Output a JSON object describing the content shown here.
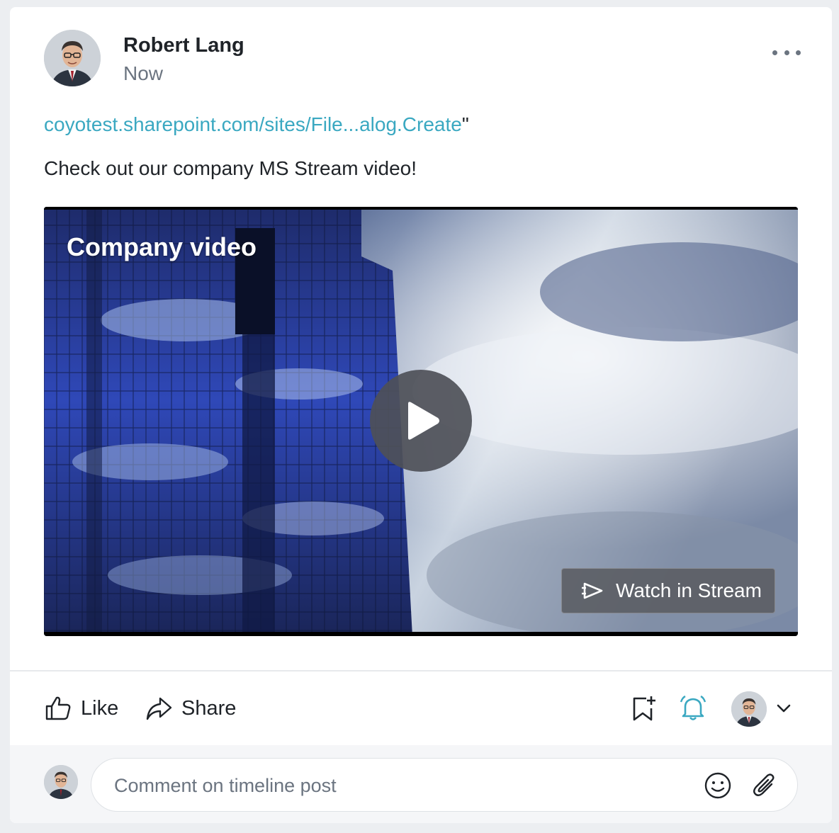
{
  "post": {
    "author": "Robert Lang",
    "time": "Now",
    "link_text": "coyotest.sharepoint.com/sites/File...alog.Create",
    "link_suffix": "\"",
    "text": "Check out our company MS Stream video!"
  },
  "video": {
    "title": "Company video",
    "watch_label": "Watch in Stream"
  },
  "actions": {
    "like_label": "Like",
    "share_label": "Share"
  },
  "comment": {
    "placeholder": "Comment on timeline post"
  },
  "colors": {
    "link": "#3aa8c1",
    "bell_accent": "#3aa8c1",
    "muted_text": "#6b7480"
  },
  "icons": [
    "more-icon",
    "play-icon",
    "stream-icon",
    "thumbs-up-icon",
    "share-icon",
    "bookmark-add-icon",
    "bell-icon",
    "chevron-down-icon",
    "emoji-icon",
    "paperclip-icon"
  ]
}
